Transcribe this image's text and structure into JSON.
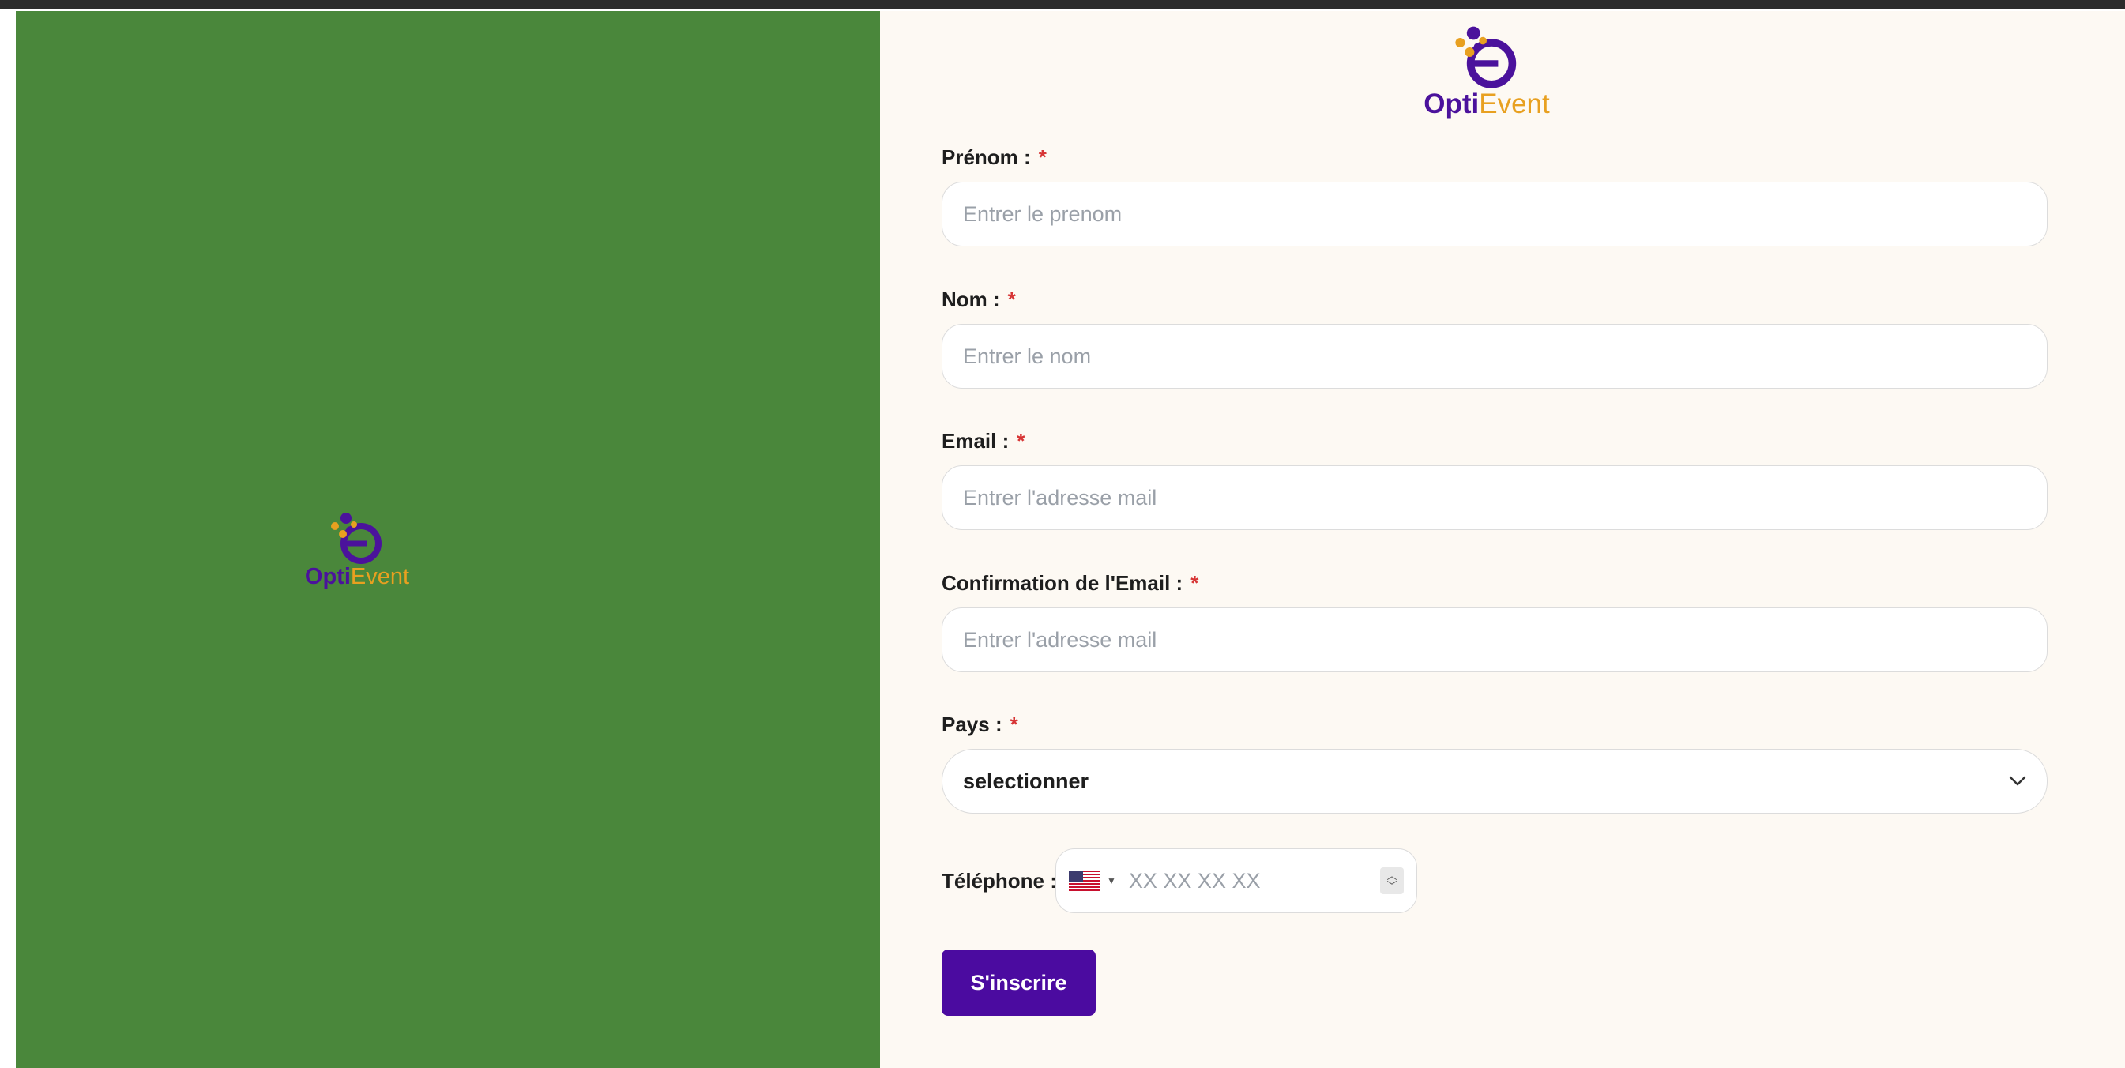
{
  "brand": {
    "opti": "Opti",
    "event": "Event",
    "logo_icon": "optievent-logo-icon"
  },
  "colors": {
    "left_panel": "#4a873b",
    "right_panel": "#fdf9f3",
    "primary": "#4b0ba0",
    "accent": "#e8a020",
    "required": "#d73535"
  },
  "form": {
    "required_mark": "*",
    "prenom": {
      "label": "Prénom :",
      "placeholder": "Entrer le prenom",
      "value": ""
    },
    "nom": {
      "label": "Nom :",
      "placeholder": "Entrer le nom",
      "value": ""
    },
    "email": {
      "label": "Email :",
      "placeholder": "Entrer l'adresse mail",
      "value": ""
    },
    "email_confirm": {
      "label": "Confirmation de l'Email :",
      "placeholder": "Entrer l'adresse mail",
      "value": ""
    },
    "pays": {
      "label": "Pays :",
      "selected": "selectionner",
      "icon": "chevron-down-icon"
    },
    "telephone": {
      "label": "Téléphone :",
      "placeholder": "XX XX XX XX",
      "country_flag": "us-flag-icon",
      "value": ""
    },
    "submit_label": "S'inscrire"
  }
}
